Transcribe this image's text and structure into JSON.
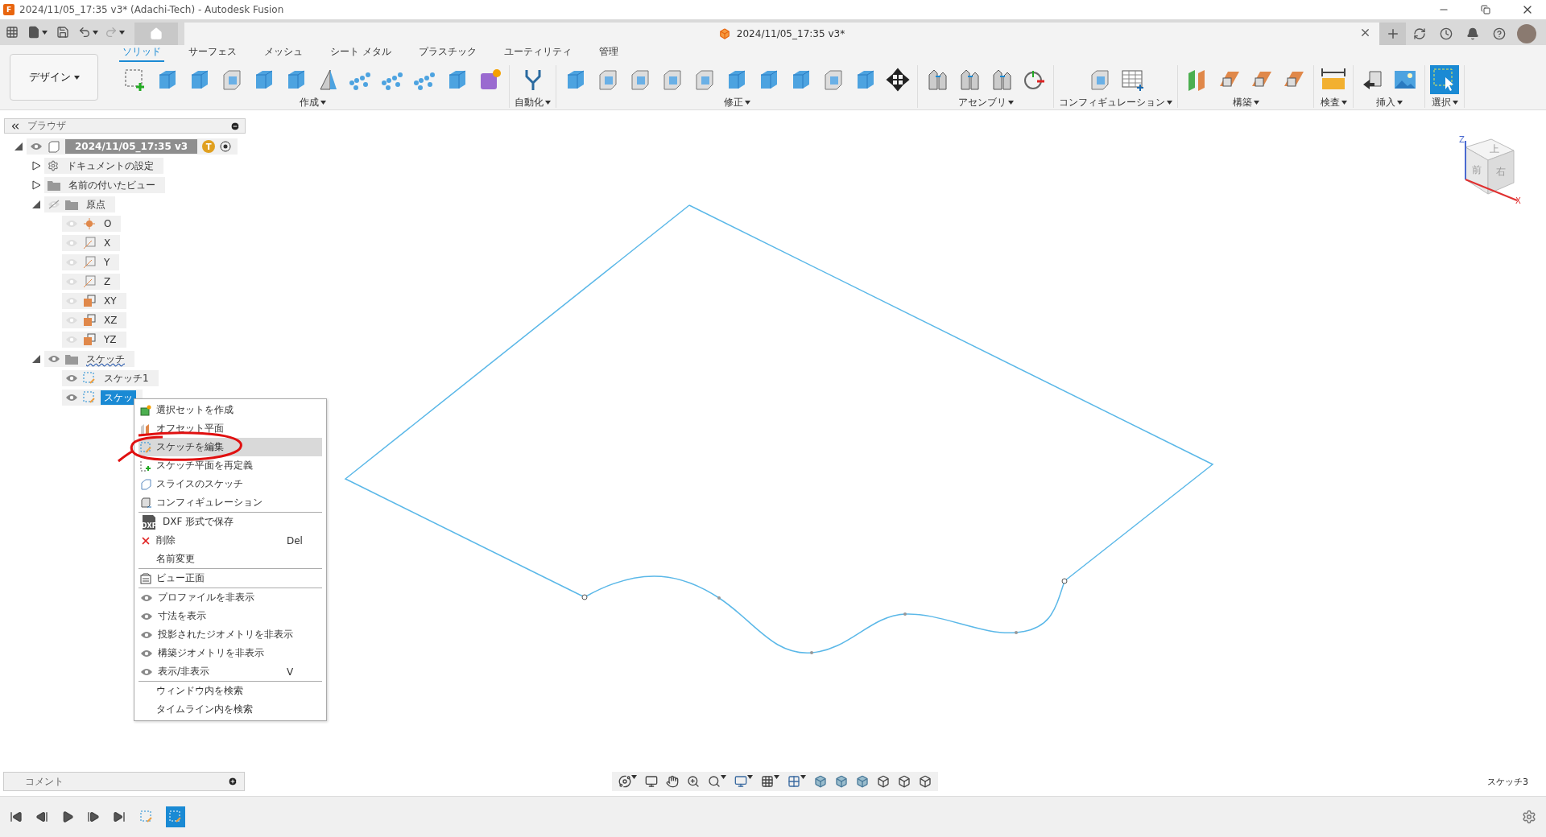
{
  "title_bar": {
    "app_badge": "F",
    "title": "2024/11/05_17:35 v3* (Adachi-Tech) - Autodesk Fusion"
  },
  "document_tab": {
    "title": "2024/11/05_17:35 v3*"
  },
  "workspace": {
    "label": "デザイン"
  },
  "ribbon_tabs": [
    {
      "label": "ソリッド",
      "selected": true
    },
    {
      "label": "サーフェス",
      "selected": false
    },
    {
      "label": "メッシュ",
      "selected": false
    },
    {
      "label": "シート メタル",
      "selected": false
    },
    {
      "label": "プラスチック",
      "selected": false
    },
    {
      "label": "ユーティリティ",
      "selected": false
    },
    {
      "label": "管理",
      "selected": false
    }
  ],
  "tool_groups": [
    {
      "label": "作成",
      "selected": false
    },
    {
      "label": "自動化",
      "selected": false
    },
    {
      "label": "修正",
      "selected": false
    },
    {
      "label": "アセンブリ",
      "selected": false
    },
    {
      "label": "コンフィギュレーション",
      "selected": false
    },
    {
      "label": "構築",
      "selected": false
    },
    {
      "label": "検査",
      "selected": false
    },
    {
      "label": "挿入",
      "selected": false
    },
    {
      "label": "選択",
      "selected": true
    }
  ],
  "browser": {
    "title": "ブラウザ",
    "root": {
      "label": "2024/11/05_17:35 v3",
      "badge": "T",
      "kind": "component",
      "expanded": true,
      "visible": true,
      "selected": false,
      "children": [
        {
          "label": "ドキュメントの設定",
          "kind": "settings",
          "expanded": false,
          "selected": false
        },
        {
          "label": "名前の付いたビュー",
          "kind": "folder",
          "expanded": false,
          "selected": false
        },
        {
          "label": "原点",
          "kind": "folder",
          "expanded": true,
          "visible": false,
          "selected": false,
          "children": [
            {
              "label": "O",
              "kind": "point",
              "visible": false,
              "selected": false
            },
            {
              "label": "X",
              "kind": "axis",
              "visible": false,
              "selected": false
            },
            {
              "label": "Y",
              "kind": "axis",
              "visible": false,
              "selected": false
            },
            {
              "label": "Z",
              "kind": "axis",
              "visible": false,
              "selected": false
            },
            {
              "label": "XY",
              "kind": "plane",
              "visible": false,
              "selected": false
            },
            {
              "label": "XZ",
              "kind": "plane",
              "visible": false,
              "selected": false
            },
            {
              "label": "YZ",
              "kind": "plane",
              "visible": false,
              "selected": false
            }
          ]
        },
        {
          "label": "スケッチ",
          "kind": "folder",
          "expanded": true,
          "visible": true,
          "warning": true,
          "selected": false,
          "children": [
            {
              "label": "スケッチ1",
              "kind": "sketch",
              "visible": true,
              "selected": false
            },
            {
              "label": "スケッ",
              "kind": "sketch",
              "visible": true,
              "selected": true
            }
          ]
        }
      ]
    }
  },
  "context_menu": {
    "sections": [
      [
        {
          "label": "選択セットを作成",
          "kind": "selection-set",
          "selected": false
        },
        {
          "label": "オフセット平面",
          "kind": "offset-plane",
          "selected": false
        },
        {
          "label": "スケッチを編集",
          "kind": "edit-sketch",
          "selected": true
        },
        {
          "label": "スケッチ平面を再定義",
          "kind": "redefine",
          "selected": false
        },
        {
          "label": "スライスのスケッチ",
          "kind": "slice",
          "selected": false
        },
        {
          "label": "コンフィギュレーション",
          "kind": "config",
          "selected": false
        }
      ],
      [
        {
          "label": "DXF 形式で保存",
          "kind": "dxf",
          "icon_text": "DXF",
          "selected": false
        },
        {
          "label": "削除",
          "kind": "delete",
          "shortcut": "Del",
          "selected": false
        },
        {
          "label": "名前変更",
          "kind": "plain",
          "selected": false
        }
      ],
      [
        {
          "label": "ビュー正面",
          "kind": "view",
          "selected": false
        }
      ],
      [
        {
          "label": "プロファイルを非表示",
          "kind": "eye",
          "selected": false
        },
        {
          "label": "寸法を表示",
          "kind": "eye",
          "selected": false
        },
        {
          "label": "投影されたジオメトリを非表示",
          "kind": "eye",
          "selected": false
        },
        {
          "label": "構築ジオメトリを非表示",
          "kind": "eye",
          "selected": false
        },
        {
          "label": "表示/非表示",
          "kind": "eye",
          "shortcut": "V",
          "selected": false
        }
      ],
      [
        {
          "label": "ウィンドウ内を検索",
          "kind": "plain",
          "selected": false
        },
        {
          "label": "タイムライン内を検索",
          "kind": "plain",
          "selected": false
        }
      ]
    ]
  },
  "view_cube": {
    "faces": [
      "上",
      "前",
      "右"
    ],
    "axes": [
      "Z",
      "X"
    ]
  },
  "comments": {
    "title": "コメント"
  },
  "status": {
    "active_sketch": "スケッチ3"
  },
  "timeline": {
    "items": [
      {
        "selected": false
      },
      {
        "selected": true
      }
    ]
  }
}
